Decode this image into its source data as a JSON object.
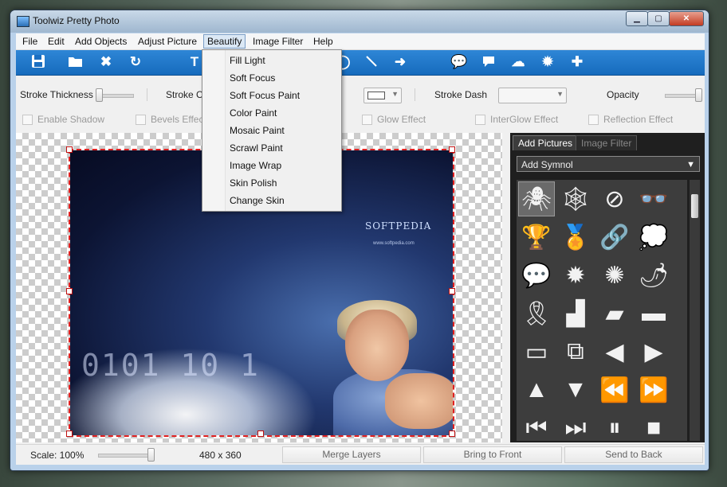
{
  "window": {
    "title": "Toolwiz Pretty Photo"
  },
  "menubar": {
    "items": [
      "File",
      "Edit",
      "Add Objects",
      "Adjust Picture",
      "Beautify",
      "Image Filter",
      "Help"
    ]
  },
  "toolbar": {
    "icons": [
      "save-icon",
      "open-folder-icon",
      "delete-x-icon",
      "refresh-icon",
      "text-tool-icon",
      "ellipse-tool-icon",
      "line-tool-icon",
      "arrow-tool-icon",
      "speech-bubble-round-icon",
      "speech-bubble-square-icon",
      "thought-bubble-icon",
      "cloud-bubble-icon",
      "puzzle-icon"
    ]
  },
  "props": {
    "stroke_thickness": "Stroke Thickness",
    "stroke_color": "Stroke Co",
    "stroke_dash": "Stroke Dash",
    "opacity": "Opacity",
    "enable_shadow": "Enable Shadow",
    "bevels_effect": "Bevels Effect",
    "glow_effect": "Glow Effect",
    "interglow_effect": "InterGlow Effect",
    "reflection_effect": "Reflection Effect"
  },
  "dropdown": {
    "items": [
      "Fill Light",
      "Soft Focus",
      "Soft Focus Paint",
      "Color Paint",
      "Mosaic Paint",
      "Scrawl Paint",
      "Image Wrap",
      "Skin Polish",
      "Change Skin"
    ]
  },
  "canvas": {
    "watermark_brand": "SOFTPEDIA",
    "watermark_url": "www.softpedia.com",
    "binary_text": "0101 10 1"
  },
  "panel": {
    "tab_add_pictures": "Add Pictures",
    "tab_image_filter": "Image Filter",
    "symbol_select": "Add Symnol",
    "symbols": [
      "spider-icon",
      "spiderweb-icon",
      "no-phone-icon",
      "sunglasses-icon",
      "trophy-icon",
      "medal-icon",
      "chain-link-icon",
      "speech-cloud-icon",
      "speech-bubble-icon",
      "explosion-burst-icon",
      "zap-burst-icon",
      "chili-pepper-icon",
      "awareness-ribbon-icon",
      "steps-icon",
      "parallelogram-icon",
      "dash-bar-icon",
      "rectangle-outline-icon",
      "double-rectangle-icon",
      "triangle-left-icon",
      "triangle-right-icon",
      "triangle-up-icon",
      "triangle-down-icon",
      "double-left-icon",
      "double-right-icon",
      "skip-back-icon",
      "skip-forward-icon",
      "pause-bars-icon",
      "square-icon"
    ]
  },
  "status": {
    "scale_label": "Scale: 100%",
    "scale_value": 100,
    "dimensions": "480 x 360",
    "merge_layers": "Merge Layers",
    "bring_to_front": "Bring to Front",
    "send_to_back": "Send to Back"
  }
}
